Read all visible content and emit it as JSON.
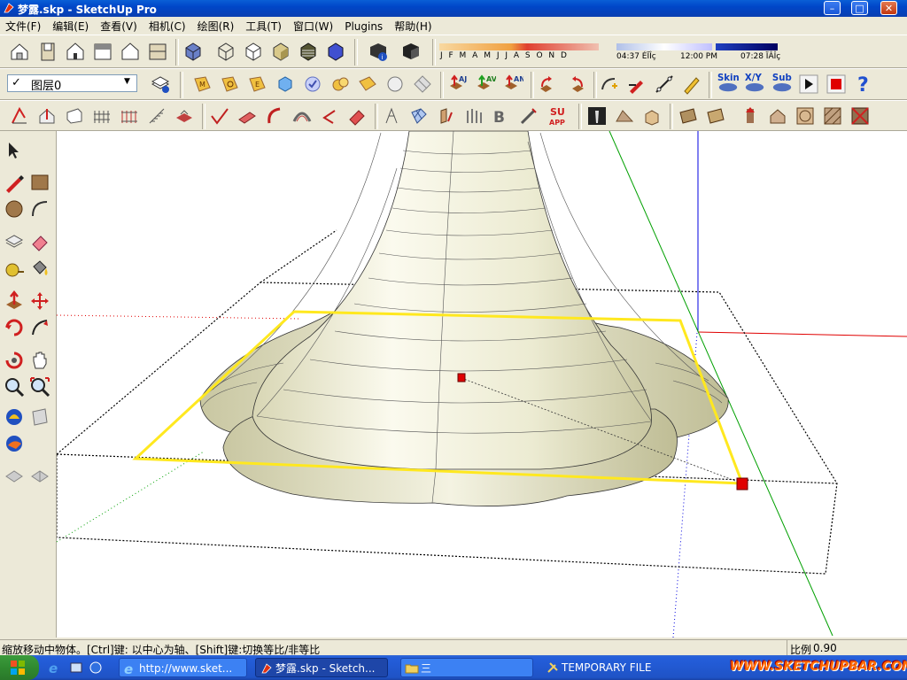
{
  "window": {
    "title": "梦露.skp - SketchUp Pro",
    "minimize": "–",
    "maximize": "□",
    "close": "✕"
  },
  "menu": [
    "文件(F)",
    "编辑(E)",
    "查看(V)",
    "相机(C)",
    "绘图(R)",
    "工具(T)",
    "窗口(W)",
    "Plugins",
    "帮助(H)"
  ],
  "shadow": {
    "months": "J F M A M J J A S O N D",
    "time_start": "04:37 ÉÏÎç",
    "time_noon": "12:00 PM",
    "time_end": "07:28 ÏÂÎç"
  },
  "layer": {
    "check": "✓",
    "name": "图层0",
    "arrow": "▼"
  },
  "plugins_text": {
    "skin": "Skin",
    "xyz": "X/Y",
    "sub": "Sub",
    "su_app": "SU APP",
    "aj": "AJ",
    "av": "AV",
    "an": "AN"
  },
  "status": {
    "hint": "缩放移动中物体。[Ctrl]键: 以中心为轴、[Shift]键:切换等比/非等比",
    "scale_label": "比例",
    "scale_value": "0.90"
  },
  "taskbar": {
    "items": [
      "http://www.sket...",
      "梦露.skp - Sketch...",
      "三",
      "TEMPORARY   FILE"
    ],
    "watermark": "WWW.SKETCHUPBAR.COM"
  },
  "colors": {
    "selection": "#ffe81f",
    "xaxis": "#e00000",
    "yaxis": "#00a000",
    "zaxis": "#0000e0",
    "model": "#f2f0dc"
  }
}
